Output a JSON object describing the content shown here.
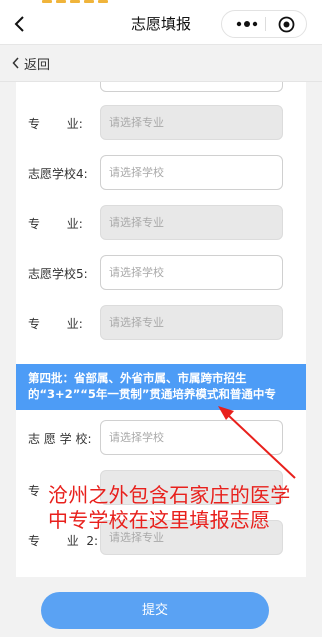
{
  "navbar": {
    "title": "志愿填报"
  },
  "subbar": {
    "back_label": "返回"
  },
  "form": {
    "rows": [
      {
        "label": "专       业:",
        "placeholder": "请选择专业",
        "disabled": true
      },
      {
        "label": "志愿学校4:",
        "placeholder": "请选择学校",
        "disabled": false
      },
      {
        "label": "专       业:",
        "placeholder": "请选择专业",
        "disabled": true
      },
      {
        "label": "志愿学校5:",
        "placeholder": "请选择学校",
        "disabled": false
      },
      {
        "label": "专       业:",
        "placeholder": "请选择专业",
        "disabled": true
      }
    ],
    "banner": "第四批：省部属、外省市属、市属跨市招生的“3+2”“5年一贯制”贯通培养模式和普通中专",
    "rows_batch4": [
      {
        "label": "志 愿 学 校:",
        "placeholder": "请选择学校",
        "disabled": false
      },
      {
        "label": "专",
        "placeholder": "",
        "disabled": true
      },
      {
        "label": "专       业  2:",
        "placeholder": "请选择专业",
        "disabled": true
      }
    ]
  },
  "annotation": {
    "text": "沧州之外包含石家庄的医学中专学校在这里填报志愿"
  },
  "submit": {
    "label": "提交"
  },
  "colors": {
    "banner": "#4d9cf6",
    "submit": "#5aa2f3",
    "annotation": "#e8201c"
  }
}
